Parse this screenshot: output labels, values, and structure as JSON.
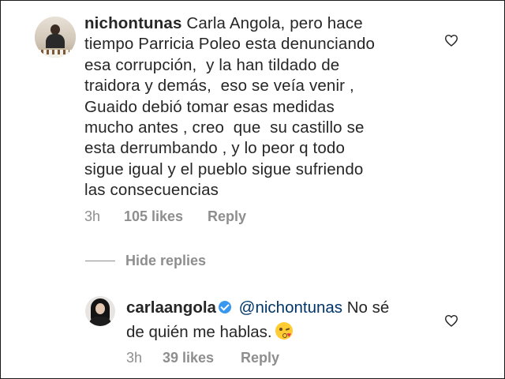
{
  "comment": {
    "username": "nichontunas",
    "text_lines": [
      "Carla Angola, pero hace",
      "tiempo Parricia Poleo esta denunciando",
      "esa corrupción,  y la han tildado de",
      "traidora y demás,  eso se veía venir ,",
      "Guaido debió tomar esas medidas",
      "mucho antes , creo  que  su castillo se",
      "esta derrumbando , y lo peor q todo",
      "sigue igual y el pueblo sigue sufriendo",
      "las consecuencias"
    ],
    "time": "3h",
    "likes": "105 likes",
    "reply_label": "Reply",
    "avatar_icon": "profile-photo",
    "like_icon": "heart-outline-icon"
  },
  "hide_replies_label": "Hide replies",
  "reply": {
    "username": "carlaangola",
    "verified_icon": "verified-badge-icon",
    "mention": "@nichontunas",
    "text_part1": "No sé",
    "text_part2": "de quién me hablas.",
    "emoji_icon": "face-blowing-kiss-emoji",
    "time": "3h",
    "likes": "39 likes",
    "reply_label": "Reply",
    "avatar_icon": "profile-photo",
    "like_icon": "heart-outline-icon"
  },
  "colors": {
    "text": "#262626",
    "meta": "#8e8e8e",
    "mention": "#003569",
    "verified": "#3897f0"
  }
}
